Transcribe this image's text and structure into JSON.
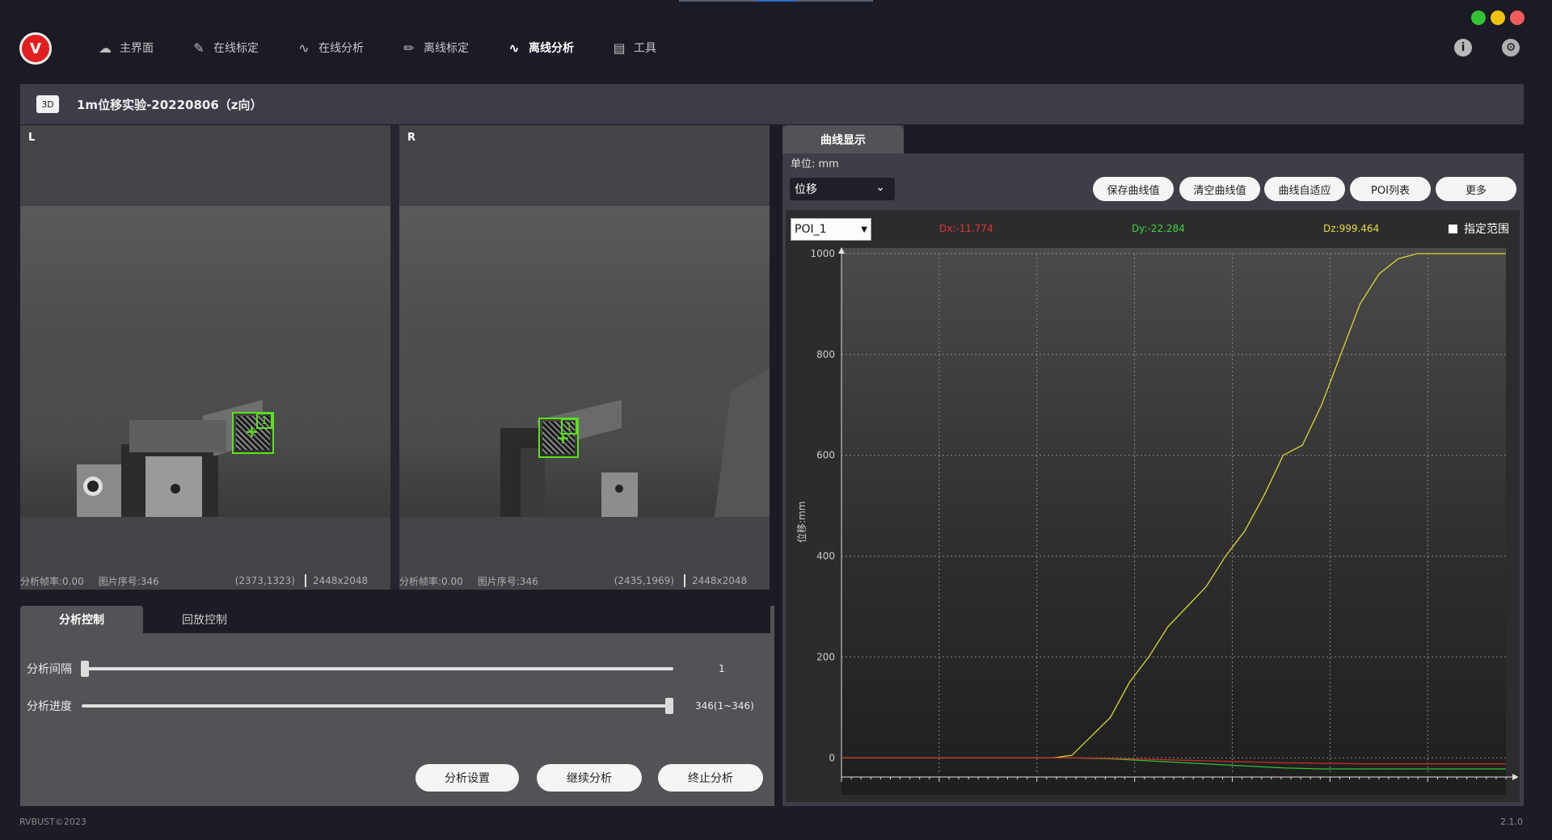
{
  "nav": {
    "items": [
      {
        "label": "主界面",
        "icon": "home-icon"
      },
      {
        "label": "在线标定",
        "icon": "calibrate-online-icon"
      },
      {
        "label": "在线分析",
        "icon": "online-analysis-icon"
      },
      {
        "label": "离线标定",
        "icon": "pencil-icon"
      },
      {
        "label": "离线分析",
        "icon": "pulse-icon"
      },
      {
        "label": "工具",
        "icon": "toolbox-icon"
      }
    ],
    "active_index": 4
  },
  "window_controls": {
    "colors": [
      "#35c232",
      "#f0c20e",
      "#f35a5a"
    ]
  },
  "title": {
    "tag": "3D",
    "text": "1m位移实验-20220806（z向）"
  },
  "cameras": [
    {
      "label": "L",
      "fps": "分析帧率:0.00",
      "img_no": "图片序号:346",
      "coord": "(2373,1323)",
      "size": "2448x2048",
      "roi_id": "1"
    },
    {
      "label": "R",
      "fps": "分析帧率:0.00",
      "img_no": "图片序号:346",
      "coord": "(2435,1969)",
      "size": "2448x2048",
      "roi_id": "1"
    }
  ],
  "control_tabs": [
    "分析控制",
    "回放控制"
  ],
  "sliders": [
    {
      "label": "分析间隔",
      "value": "1",
      "fraction": 0.0
    },
    {
      "label": "分析进度",
      "value": "346(1~346)",
      "fraction": 1.0
    }
  ],
  "buttons": {
    "settings": "分析设置",
    "continue": "继续分析",
    "stop": "终止分析"
  },
  "right_panel": {
    "tab": "曲线显示",
    "unit": "单位: mm",
    "dropdown": "位移",
    "buttons": [
      "保存曲线值",
      "清空曲线值",
      "曲线自适应",
      "POI列表",
      "更多"
    ],
    "poi": "POI_1",
    "dx": "Dx:-11.774",
    "dy": "Dy:-22.284",
    "dz": "Dz:999.464",
    "range_label": "指定范围"
  },
  "chart_data": {
    "type": "line",
    "ylabel": "位移:mm",
    "ylim": [
      0,
      1000
    ],
    "yticks": [
      0,
      200,
      400,
      600,
      800,
      1000
    ],
    "x": [
      0,
      20,
      40,
      60,
      80,
      100,
      110,
      120,
      140,
      150,
      160,
      170,
      180,
      190,
      200,
      210,
      220,
      230,
      240,
      250,
      260,
      270,
      280,
      290,
      300,
      310,
      320,
      330,
      346
    ],
    "series": [
      {
        "color": "#d8d832",
        "values": [
          0,
          0,
          0,
          0,
          0,
          0,
          0,
          5,
          80,
          150,
          200,
          260,
          300,
          340,
          400,
          450,
          520,
          600,
          620,
          700,
          800,
          900,
          960,
          990,
          1000,
          1000,
          1000,
          1000,
          1000
        ]
      },
      {
        "color": "#2fc12f",
        "values": [
          0,
          0,
          0,
          0,
          0,
          0,
          0,
          0,
          -2,
          -4,
          -6,
          -8,
          -10,
          -12,
          -14,
          -16,
          -18,
          -20,
          -21,
          -22,
          -22,
          -22,
          -22,
          -22,
          -22,
          -22,
          -22,
          -22,
          -22
        ]
      },
      {
        "color": "#d32a2a",
        "values": [
          0,
          0,
          0,
          0,
          0,
          0,
          0,
          0,
          -1,
          -2,
          -3,
          -4,
          -5,
          -6,
          -7,
          -8,
          -9,
          -10,
          -10,
          -11,
          -11,
          -12,
          -12,
          -12,
          -12,
          -12,
          -12,
          -12,
          -12
        ]
      }
    ],
    "grid": true
  },
  "footer": {
    "copyright": "RVBUST©2023",
    "version": "2.1.0"
  }
}
